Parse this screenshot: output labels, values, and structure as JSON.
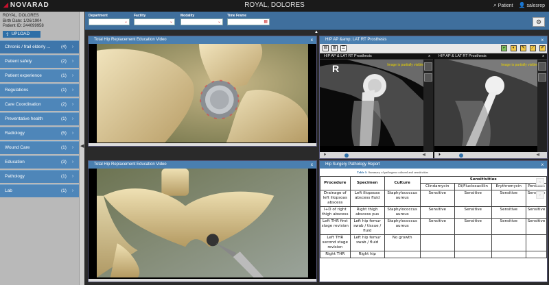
{
  "app": {
    "brand": "NOVARAD",
    "title": "ROYAL, DOLORES",
    "patient_link": "Patient",
    "user_link": "salesrep"
  },
  "patient": {
    "name": "ROYAL, DOLORES",
    "birth_date": "Birth Date: 1/26/1904",
    "patient_id": "Patient ID: 244099958"
  },
  "sidebar": {
    "upload_label": "UPLOAD",
    "items": [
      {
        "label": "Chronic / frail elderly ...",
        "count": "(4)"
      },
      {
        "label": "Patient safety",
        "count": "(2)"
      },
      {
        "label": "Patient experience",
        "count": "(1)"
      },
      {
        "label": "Regulations",
        "count": "(1)"
      },
      {
        "label": "Care Coordination",
        "count": "(2)"
      },
      {
        "label": "Preventative health",
        "count": "(1)"
      },
      {
        "label": "Radiology",
        "count": "(5)"
      },
      {
        "label": "Wound Care",
        "count": "(1)"
      },
      {
        "label": "Education",
        "count": "(3)"
      },
      {
        "label": "Pathology",
        "count": "(1)"
      },
      {
        "label": "Lab",
        "count": "(1)"
      }
    ]
  },
  "filters": {
    "department_label": "Department",
    "facility_label": "Facility",
    "modality_label": "Modality",
    "timeframe_label": "Time Frame"
  },
  "panels": {
    "video_top_title": "Total Hip Replacement Education Video",
    "video_bottom_title": "Total Hip Replacement Education Video",
    "xray_title": "HIP AP &amp; LAT RT Prosthesis",
    "xray_view_left_title": "HIP AP & LAT RT Prosthesis",
    "xray_view_right_title": "HIP AP & LAT RT Prosthesis",
    "xray_note": "Image is partially visible",
    "xray_marker": "R",
    "report_title": "Hip Surgery Pathology Report",
    "close": "x"
  },
  "report": {
    "caption_label": "Table 1:",
    "caption_text": "Summary of pathogens cultured and sensitivities",
    "headers": [
      "Procedure",
      "Specimen",
      "Culture",
      "Sensitivities"
    ],
    "sub_headers": [
      "Clindamycin",
      "Di/Flucloxacillin",
      "Erythromycin",
      "Penicillin"
    ],
    "rows": [
      {
        "procedure": "Drainage of left iliopsoas abscess",
        "specimen": "Left iliopsoas abscess fluid",
        "culture": "Staphylococcus aureus",
        "s": [
          "Sensitive",
          "Sensitive",
          "Sensitive",
          "Sensitive"
        ]
      },
      {
        "procedure": "I+D of right thigh abscess",
        "specimen": "Right thigh abscess pus",
        "culture": "Staphylococcus aureus",
        "s": [
          "Sensitive",
          "Sensitive",
          "Sensitive",
          "Sensitive"
        ]
      },
      {
        "procedure": "Left THR first stage revision",
        "specimen": "Left hip femur swab / tissue / fluid",
        "culture": "Staphylococcus aureus",
        "s": [
          "Sensitive",
          "Sensitive",
          "Sensitive",
          "Sensitive"
        ]
      },
      {
        "procedure": "Left THR second stage revision",
        "specimen": "Left hip femur swab / fluid",
        "culture": "No growth",
        "s": [
          "",
          "",
          "",
          ""
        ]
      },
      {
        "procedure": "Right THR",
        "specimen": "Right hip",
        "culture": "",
        "s": [
          "",
          "",
          "",
          ""
        ]
      }
    ]
  },
  "colors": {
    "accent": "#4a7fb0",
    "sidebar_item": "#4e86b9",
    "note": "#e8d200"
  }
}
